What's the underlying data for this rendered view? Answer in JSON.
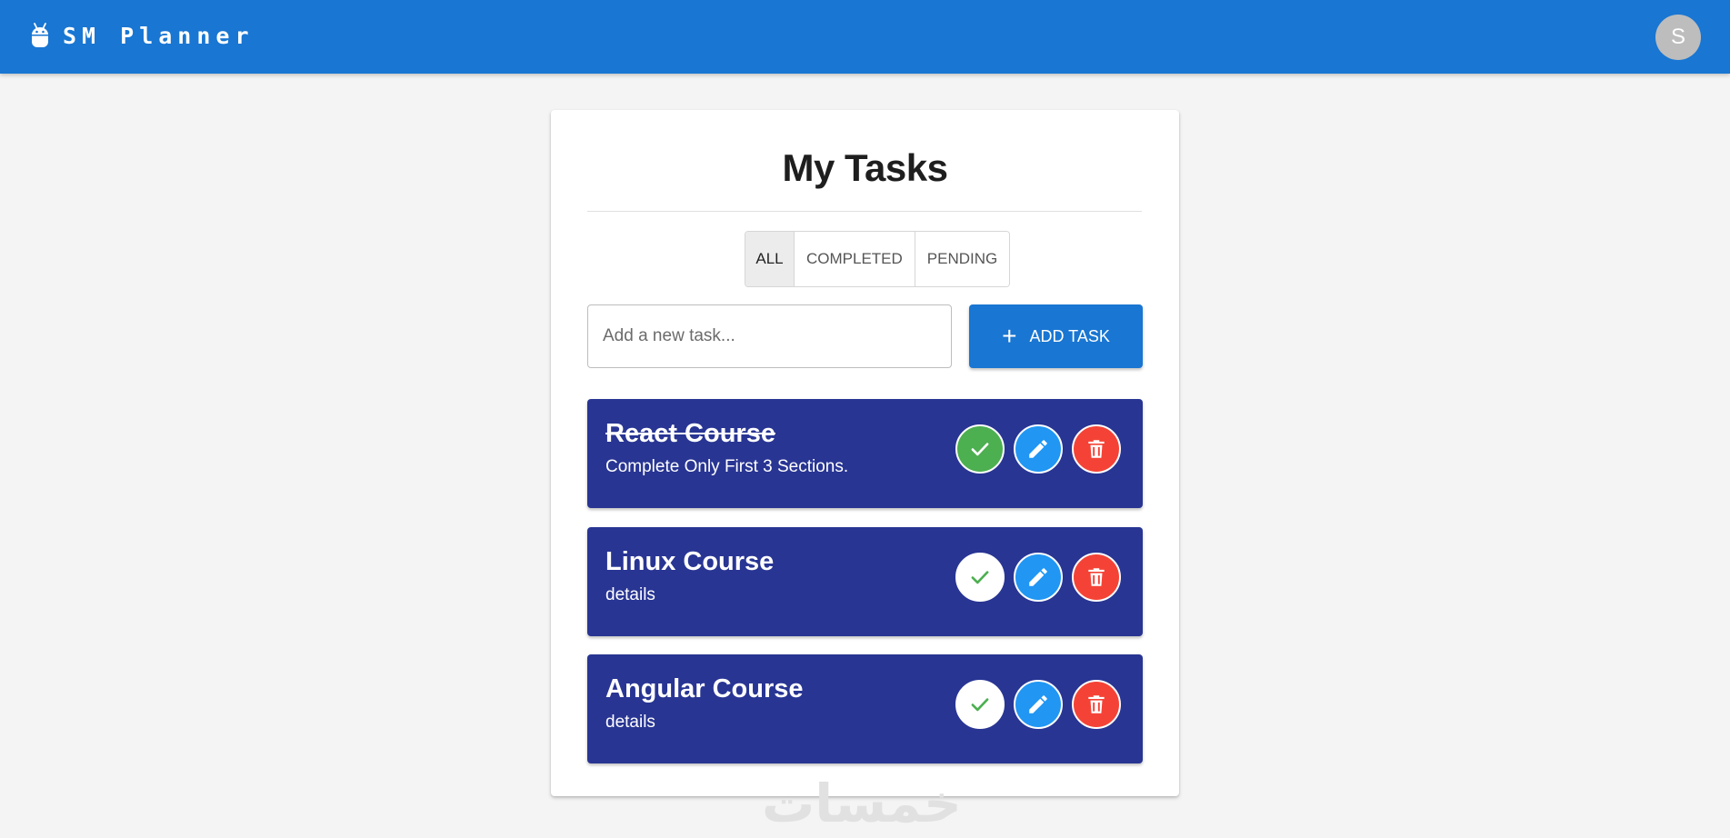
{
  "appbar": {
    "icon": "android-icon",
    "title": "SM Planner",
    "avatar_letter": "S",
    "color": "#1976d2"
  },
  "main": {
    "title": "My Tasks",
    "filters": [
      {
        "label": "All",
        "active": true
      },
      {
        "label": "Completed",
        "active": false
      },
      {
        "label": "Pending",
        "active": false
      }
    ],
    "input": {
      "placeholder": "Add a new task...",
      "value": ""
    },
    "add_button": {
      "label": "Add Task",
      "icon": "plus-icon"
    }
  },
  "tasks": [
    {
      "title": "React Course",
      "details": "Complete Only First 3 Sections.",
      "completed": true
    },
    {
      "title": "Linux Course",
      "details": "details",
      "completed": false
    },
    {
      "title": "Angular Course",
      "details": "details",
      "completed": false
    }
  ],
  "colors": {
    "task_bg": "#283593",
    "complete": "#4caf50",
    "edit": "#2196f3",
    "delete": "#f44336"
  },
  "watermark": "خمسات"
}
